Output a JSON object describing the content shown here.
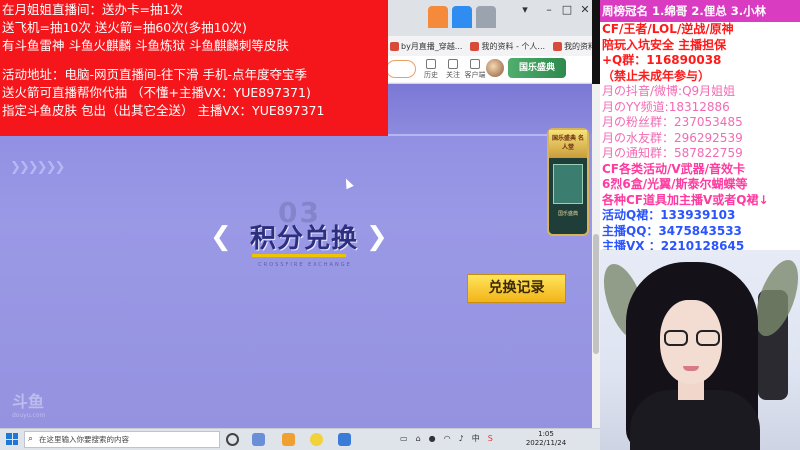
{
  "promo_overlay": {
    "lines": [
      "在月姐姐直播间：送办卡=抽1次",
      "送飞机=抽10次  送火箭=抽60次(多抽10次)",
      "有斗鱼雷神 斗鱼火麒麟 斗鱼炼狱 斗鱼麒麟刺等皮肤",
      "活动地址：电脑-网页直播间-往下滑  手机-点年度夺宝季",
      "送火箭可直播帮你代抽 （不懂+主播VX：YUE897371)",
      "指定斗鱼皮肤 包出（出其它全送）     主播VX：YUE897371"
    ]
  },
  "browser": {
    "bookmarks": [
      "by月直播_穿越...",
      "我的资料 - 个人...",
      "我的资料 - 个人..."
    ],
    "header_icons": [
      "历史",
      "关注",
      "客户端"
    ],
    "banner_ad": "国乐盛典",
    "section_number": "03",
    "section_title": "积分兑换",
    "section_subtitle": "CROSSFIRE EXCHANGE",
    "exchange_button": "兑换记录",
    "side_widget_title": "国乐盛典 名人堂",
    "side_widget_caption": "国乐盛典",
    "watermark": "斗鱼",
    "watermark_sub": "douyu.com"
  },
  "taskbar": {
    "search_placeholder": "在这里输入你要搜索的内容",
    "tray_lang": "中",
    "tray_ime": "S",
    "clock_time": "1:05",
    "clock_date": "2022/11/24"
  },
  "info_panel": {
    "header": "周榜冠名 1.绵哥 2.俚总 3.小林",
    "lines": [
      {
        "text": "CF/王者/LOL/逆战/原神",
        "color": "red"
      },
      {
        "text": "陪玩入坑安全 主播担保",
        "color": "red"
      },
      {
        "text": "+Q群：116890038",
        "color": "red"
      },
      {
        "text": "（禁止未成年参与）",
        "color": "red"
      },
      {
        "text": "月の抖音/微博:Q9月姐姐",
        "color": "pink"
      },
      {
        "text": "月のYY频道:18312886",
        "color": "pink"
      },
      {
        "text": "月の粉丝群：237053485",
        "color": "pink"
      },
      {
        "text": "月の水友群：296292539",
        "color": "pink"
      },
      {
        "text": "月の通知群：587822759",
        "color": "pink"
      },
      {
        "text": "CF各类活动/V武器/音效卡",
        "color": "mag"
      },
      {
        "text": "6烈6盒/光翼/斯泰尔蝴蝶等",
        "color": "mag"
      },
      {
        "text": "各种CF道具加主播V或者Q裙↓",
        "color": "mag"
      },
      {
        "text": "活动Q裙：133939103",
        "color": "blue"
      },
      {
        "text": "主播QQ：3475843533",
        "color": "blue"
      },
      {
        "text": "主播VX ：2210128645",
        "color": "blue"
      }
    ]
  },
  "colors": {
    "promo_bg": "#f5161b",
    "page_bg": "#8e8cd8",
    "button_yellow": "#f2b41a",
    "header_magenta": "#d93cc0"
  }
}
